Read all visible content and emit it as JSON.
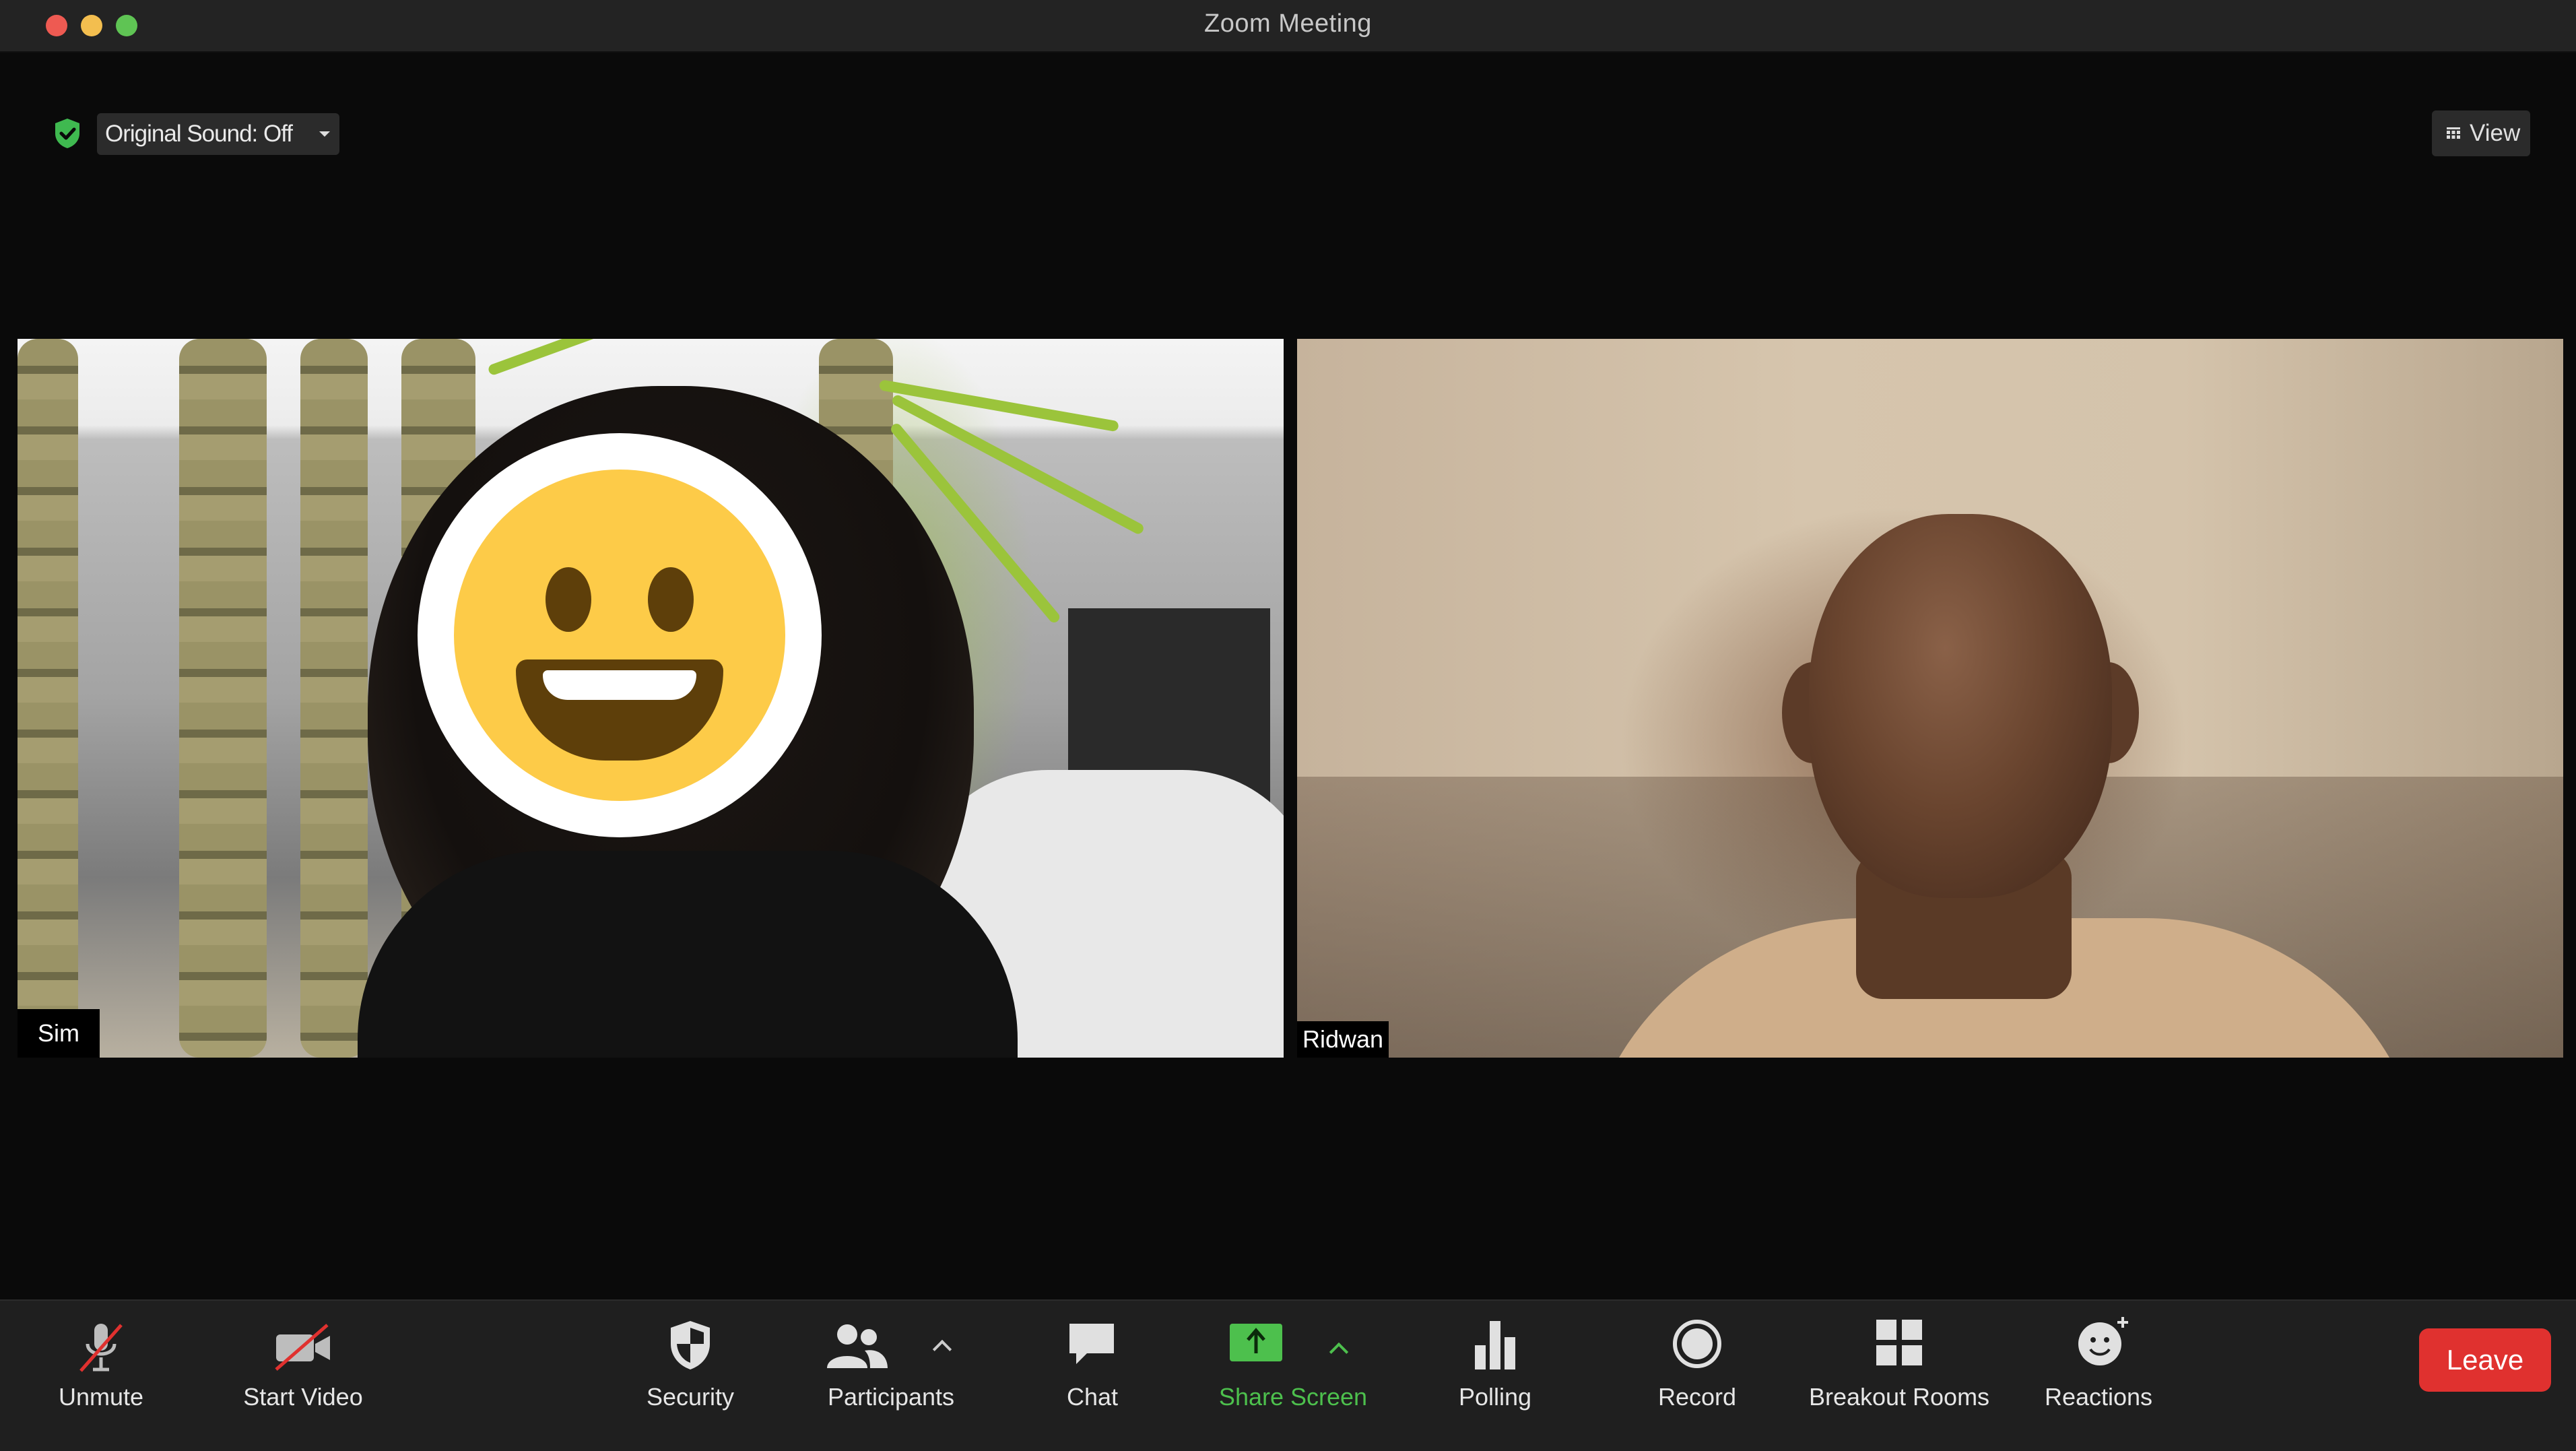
{
  "window": {
    "title": "Zoom Meeting"
  },
  "top_controls": {
    "original_sound_label": "Original Sound: Off",
    "view_label": "View"
  },
  "participants": [
    {
      "name": "Sim"
    },
    {
      "name": "Ridwan"
    }
  ],
  "toolbar": {
    "unmute": "Unmute",
    "start_video": "Start Video",
    "security": "Security",
    "participants": "Participants",
    "chat": "Chat",
    "share_screen": "Share Screen",
    "polling": "Polling",
    "record": "Record",
    "breakout_rooms": "Breakout Rooms",
    "reactions": "Reactions",
    "leave": "Leave"
  },
  "colors": {
    "share_green": "#4dc04d",
    "leave_red": "#e0312f",
    "toolbar_bg": "#1f1f1f",
    "encryption_shield": "#3fb950"
  },
  "icons": [
    "shield-check-icon",
    "caret-down-icon",
    "grid-view-icon",
    "microphone-muted-icon",
    "camera-off-icon",
    "shield-icon",
    "participants-icon",
    "chevron-up-icon",
    "chat-bubble-icon",
    "share-screen-icon",
    "bar-chart-icon",
    "record-icon",
    "breakout-rooms-icon",
    "reaction-smiley-icon"
  ]
}
